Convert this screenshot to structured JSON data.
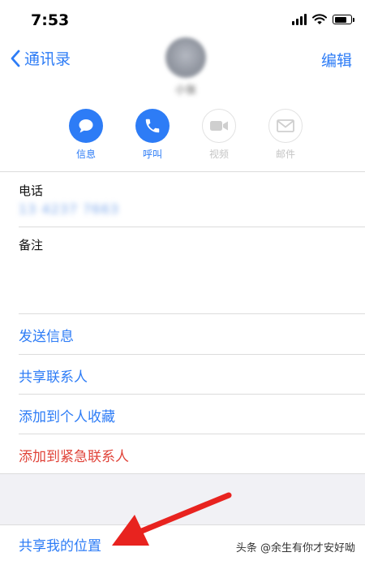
{
  "status_bar": {
    "time": "7:53",
    "battery_level": 0.8
  },
  "nav": {
    "back_label": "通讯录",
    "edit_label": "编辑"
  },
  "contact": {
    "name": "小张"
  },
  "actions": [
    {
      "label": "信息",
      "icon": "message-icon",
      "enabled": true
    },
    {
      "label": "呼叫",
      "icon": "phone-icon",
      "enabled": true
    },
    {
      "label": "视频",
      "icon": "video-icon",
      "enabled": false
    },
    {
      "label": "邮件",
      "icon": "mail-icon",
      "enabled": false
    }
  ],
  "phone": {
    "label": "电话",
    "value": "13 4237 7663"
  },
  "notes": {
    "label": "备注"
  },
  "links": {
    "send_message": "发送信息",
    "share_contact": "共享联系人",
    "add_favorite": "添加到个人收藏",
    "add_emergency": "添加到紧急联系人",
    "share_location": "共享我的位置"
  },
  "watermark": {
    "text": "头条 @余生有你才安好呦"
  },
  "colors": {
    "accent": "#2d7cf6",
    "danger": "#e0443a",
    "arrow": "#e8231f",
    "band": "#f1f1f5"
  }
}
